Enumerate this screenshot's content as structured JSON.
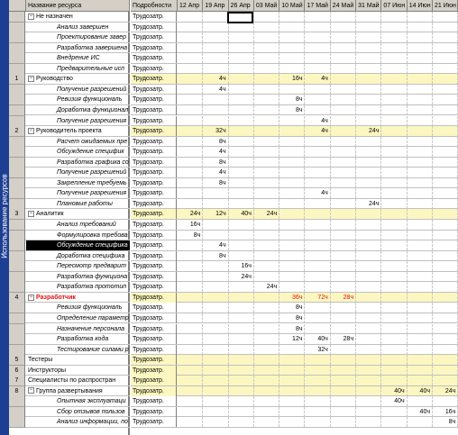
{
  "sidebar": {
    "label": "Использование ресурсов"
  },
  "header": {
    "name_label": "Название ресурса",
    "detail_label": "Подробности",
    "weeks": [
      "12 Апр",
      "19 Апр",
      "26 Апр",
      "03 Май",
      "10 Май",
      "17 Май",
      "24 Май",
      "31 Май",
      "07 Июн",
      "14 Июн",
      "21 Июн"
    ]
  },
  "colors": {
    "sidebar": "#1d3f93",
    "summary_highlight": "#fcf7c0",
    "over_allocated": "#e01010"
  },
  "rows": [
    {
      "num": "",
      "name": "Не назначен",
      "kind": "summary",
      "toggle": "−",
      "detail": "Трудозатр.",
      "values": [
        "",
        "",
        "",
        "",
        "",
        "",
        "",
        "",
        "",
        "",
        ""
      ]
    },
    {
      "num": "",
      "name": "Анализ завершен",
      "kind": "child",
      "detail": "Трудозатр.",
      "values": [
        "",
        "",
        "",
        "",
        "",
        "",
        "",
        "",
        "",
        "",
        ""
      ]
    },
    {
      "num": "",
      "name": "Проектирование завер",
      "kind": "child",
      "detail": "Трудозатр.",
      "values": [
        "",
        "",
        "",
        "",
        "",
        "",
        "",
        "",
        "",
        "",
        ""
      ]
    },
    {
      "num": "",
      "name": "Разработка завершена",
      "kind": "child",
      "detail": "Трудозатр.",
      "values": [
        "",
        "",
        "",
        "",
        "",
        "",
        "",
        "",
        "",
        "",
        ""
      ]
    },
    {
      "num": "",
      "name": "Внедрение ИС",
      "kind": "child",
      "detail": "Трудозатр.",
      "values": [
        "",
        "",
        "",
        "",
        "",
        "",
        "",
        "",
        "",
        "",
        ""
      ]
    },
    {
      "num": "",
      "name": "Предварительные исп",
      "kind": "child",
      "detail": "Трудозатр.",
      "values": [
        "",
        "",
        "",
        "",
        "",
        "",
        "",
        "",
        "",
        "",
        ""
      ]
    },
    {
      "num": "1",
      "name": "Руководство",
      "kind": "summary",
      "toggle": "−",
      "detail": "Трудозатр.",
      "highlight": true,
      "values": [
        "",
        "4ч",
        "",
        "",
        "16ч",
        "4ч",
        "",
        "",
        "",
        "",
        ""
      ]
    },
    {
      "num": "",
      "name": "Получение разрешений",
      "kind": "child",
      "detail": "Трудозатр.",
      "values": [
        "",
        "4ч",
        "",
        "",
        "",
        "",
        "",
        "",
        "",
        "",
        ""
      ]
    },
    {
      "num": "",
      "name": "Ревизия функциональ",
      "kind": "child",
      "detail": "Трудозатр.",
      "values": [
        "",
        "",
        "",
        "",
        "8ч",
        "",
        "",
        "",
        "",
        "",
        ""
      ]
    },
    {
      "num": "",
      "name": "Доработка функционал",
      "kind": "child",
      "detail": "Трудозатр.",
      "values": [
        "",
        "",
        "",
        "",
        "8ч",
        "",
        "",
        "",
        "",
        "",
        ""
      ]
    },
    {
      "num": "",
      "name": "Получение разрешения",
      "kind": "child",
      "detail": "Трудозатр.",
      "values": [
        "",
        "",
        "",
        "",
        "",
        "4ч",
        "",
        "",
        "",
        "",
        ""
      ]
    },
    {
      "num": "2",
      "name": "Руководитель проекта",
      "kind": "summary",
      "toggle": "−",
      "detail": "Трудозатр.",
      "highlight": true,
      "values": [
        "",
        "32ч",
        "",
        "",
        "",
        "4ч",
        "",
        "24ч",
        "",
        "",
        ""
      ]
    },
    {
      "num": "",
      "name": "Расчет ожидаемых пре",
      "kind": "child",
      "detail": "Трудозатр.",
      "values": [
        "",
        "8ч",
        "",
        "",
        "",
        "",
        "",
        "",
        "",
        "",
        ""
      ]
    },
    {
      "num": "",
      "name": "Обсуждение специфик",
      "kind": "child",
      "detail": "Трудозатр.",
      "values": [
        "",
        "4ч",
        "",
        "",
        "",
        "",
        "",
        "",
        "",
        "",
        ""
      ]
    },
    {
      "num": "",
      "name": "Разработка графика со",
      "kind": "child",
      "detail": "Трудозатр.",
      "values": [
        "",
        "8ч",
        "",
        "",
        "",
        "",
        "",
        "",
        "",
        "",
        ""
      ]
    },
    {
      "num": "",
      "name": "Получение разрешений",
      "kind": "child",
      "detail": "Трудозатр.",
      "values": [
        "",
        "4ч",
        "",
        "",
        "",
        "",
        "",
        "",
        "",
        "",
        ""
      ]
    },
    {
      "num": "",
      "name": "Закрепление требуемь",
      "kind": "child",
      "detail": "Трудозатр.",
      "values": [
        "",
        "8ч",
        "",
        "",
        "",
        "",
        "",
        "",
        "",
        "",
        ""
      ]
    },
    {
      "num": "",
      "name": "Получение разрешения",
      "kind": "child",
      "detail": "Трудозатр.",
      "values": [
        "",
        "",
        "",
        "",
        "",
        "4ч",
        "",
        "",
        "",
        "",
        ""
      ]
    },
    {
      "num": "",
      "name": "Плановые работы",
      "kind": "child",
      "detail": "Трудозатр.",
      "values": [
        "",
        "",
        "",
        "",
        "",
        "",
        "",
        "24ч",
        "",
        "",
        ""
      ]
    },
    {
      "num": "3",
      "name": "Аналитик",
      "kind": "summary",
      "toggle": "−",
      "detail": "Трудозатр.",
      "highlight": true,
      "values": [
        "24ч",
        "12ч",
        "40ч",
        "24ч",
        "",
        "",
        "",
        "",
        "",
        "",
        ""
      ]
    },
    {
      "num": "",
      "name": "Анализ требований",
      "kind": "child",
      "detail": "Трудозатр.",
      "values": [
        "16ч",
        "",
        "",
        "",
        "",
        "",
        "",
        "",
        "",
        "",
        ""
      ]
    },
    {
      "num": "",
      "name": "Формулировка требова",
      "kind": "child",
      "detail": "Трудозатр.",
      "values": [
        "8ч",
        "",
        "",
        "",
        "",
        "",
        "",
        "",
        "",
        "",
        ""
      ]
    },
    {
      "num": "",
      "name": "Обсуждение специфика",
      "kind": "child",
      "detail": "Трудозатр.",
      "selected": true,
      "values": [
        "",
        "4ч",
        "",
        "",
        "",
        "",
        "",
        "",
        "",
        "",
        ""
      ]
    },
    {
      "num": "",
      "name": "Доработка специфика",
      "kind": "child",
      "detail": "Трудозатр.",
      "values": [
        "",
        "8ч",
        "",
        "",
        "",
        "",
        "",
        "",
        "",
        "",
        ""
      ]
    },
    {
      "num": "",
      "name": "Пересмотр предварит",
      "kind": "child",
      "detail": "Трудозатр.",
      "values": [
        "",
        "",
        "16ч",
        "",
        "",
        "",
        "",
        "",
        "",
        "",
        ""
      ]
    },
    {
      "num": "",
      "name": "Разработка функциона",
      "kind": "child",
      "detail": "Трудозатр.",
      "values": [
        "",
        "",
        "24ч",
        "",
        "",
        "",
        "",
        "",
        "",
        "",
        ""
      ]
    },
    {
      "num": "",
      "name": "Разработка прототип",
      "kind": "child",
      "detail": "Трудозатр.",
      "values": [
        "",
        "",
        "",
        "24ч",
        "",
        "",
        "",
        "",
        "",
        "",
        ""
      ]
    },
    {
      "num": "4",
      "name": "Разработчик",
      "kind": "summary",
      "toggle": "−",
      "detail": "Трудозатр.",
      "highlight": true,
      "red": true,
      "values": [
        "",
        "",
        "",
        "",
        "36ч",
        "72ч",
        "28ч",
        "",
        "",
        "",
        ""
      ]
    },
    {
      "num": "",
      "name": "Ревизия функциональ",
      "kind": "child",
      "detail": "Трудозатр.",
      "values": [
        "",
        "",
        "",
        "",
        "8ч",
        "",
        "",
        "",
        "",
        "",
        ""
      ]
    },
    {
      "num": "",
      "name": "Определение параметр",
      "kind": "child",
      "detail": "Трудозатр.",
      "values": [
        "",
        "",
        "",
        "",
        "8ч",
        "",
        "",
        "",
        "",
        "",
        ""
      ]
    },
    {
      "num": "",
      "name": "Назначение персонала",
      "kind": "child",
      "detail": "Трудозатр.",
      "values": [
        "",
        "",
        "",
        "",
        "8ч",
        "",
        "",
        "",
        "",
        "",
        ""
      ]
    },
    {
      "num": "",
      "name": "Разработка кода",
      "kind": "child",
      "detail": "Трудозатр.",
      "values": [
        "",
        "",
        "",
        "",
        "12ч",
        "40ч",
        "28ч",
        "",
        "",
        "",
        ""
      ]
    },
    {
      "num": "",
      "name": "Тестирование силами р",
      "kind": "child",
      "detail": "Трудозатр.",
      "values": [
        "",
        "",
        "",
        "",
        "",
        "32ч",
        "",
        "",
        "",
        "",
        ""
      ]
    },
    {
      "num": "5",
      "name": "Тестеры",
      "kind": "summary",
      "detail": "Трудозатр.",
      "highlight": true,
      "values": [
        "",
        "",
        "",
        "",
        "",
        "",
        "",
        "",
        "",
        "",
        ""
      ]
    },
    {
      "num": "6",
      "name": "Инструкторы",
      "kind": "summary",
      "detail": "Трудозатр.",
      "highlight": true,
      "values": [
        "",
        "",
        "",
        "",
        "",
        "",
        "",
        "",
        "",
        "",
        ""
      ]
    },
    {
      "num": "7",
      "name": "Специалисты по распростран",
      "kind": "summary",
      "detail": "Трудозатр.",
      "highlight": true,
      "values": [
        "",
        "",
        "",
        "",
        "",
        "",
        "",
        "",
        "",
        "",
        ""
      ]
    },
    {
      "num": "8",
      "name": "Группа развертывания",
      "kind": "summary",
      "toggle": "−",
      "detail": "Трудозатр.",
      "highlight": true,
      "values": [
        "",
        "",
        "",
        "",
        "",
        "",
        "",
        "",
        "40ч",
        "40ч",
        "24ч"
      ]
    },
    {
      "num": "",
      "name": "Опытная эксплуатаци",
      "kind": "child",
      "detail": "Трудозатр.",
      "values": [
        "",
        "",
        "",
        "",
        "",
        "",
        "",
        "",
        "40ч",
        "",
        ""
      ]
    },
    {
      "num": "",
      "name": "Сбор отзывов пользов",
      "kind": "child",
      "detail": "Трудозатр.",
      "values": [
        "",
        "",
        "",
        "",
        "",
        "",
        "",
        "",
        "",
        "40ч",
        "16ч"
      ]
    },
    {
      "num": "",
      "name": "Анализ информации, по",
      "kind": "child",
      "detail": "Трудозатр.",
      "values": [
        "",
        "",
        "",
        "",
        "",
        "",
        "",
        "",
        "",
        "",
        "8ч"
      ]
    }
  ]
}
